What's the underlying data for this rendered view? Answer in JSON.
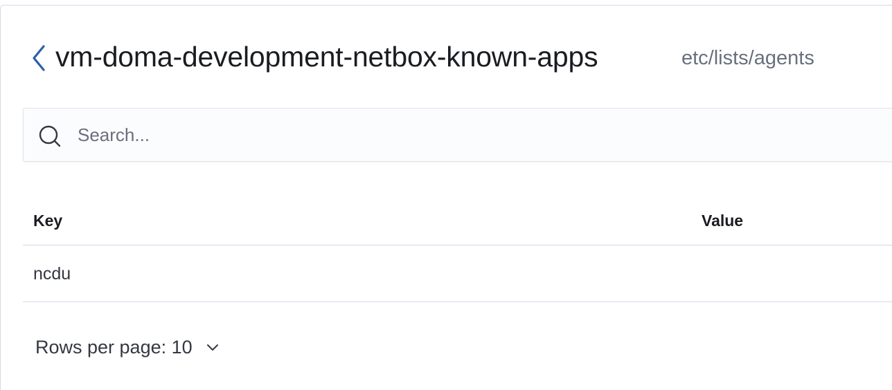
{
  "header": {
    "title": "vm-doma-development-netbox-known-apps",
    "path": "etc/lists/agents",
    "back_icon": "chevron-left-icon"
  },
  "search": {
    "placeholder": "Search...",
    "value": "",
    "icon": "search-icon"
  },
  "table": {
    "columns": [
      "Key",
      "Value"
    ],
    "rows": [
      {
        "key": "ncdu",
        "value": ""
      }
    ]
  },
  "pagination": {
    "rows_per_page_label": "Rows per page: 10",
    "icon": "chevron-down-icon"
  },
  "colors": {
    "accent": "#2b5fa8",
    "border": "#d3dae6",
    "muted_text": "#69707d",
    "text": "#1a1c21"
  }
}
